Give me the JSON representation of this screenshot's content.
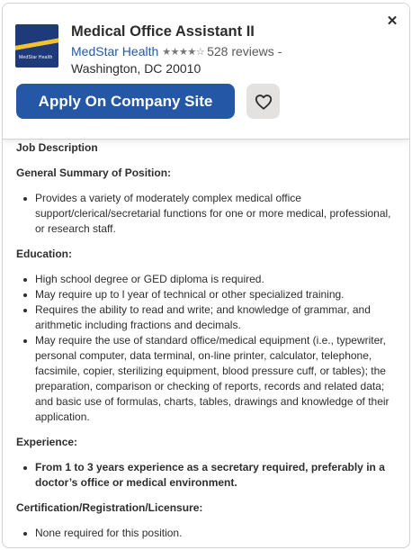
{
  "job": {
    "title": "Medical Office Assistant II",
    "company": "MedStar Health",
    "rating": 3.5,
    "reviews": "528 reviews",
    "separator": "-",
    "location": "Washington, DC 20010"
  },
  "logo": {
    "text": "MedStar Health",
    "colors": {
      "bg": "#1f3a7a",
      "accent": "#f2c230"
    }
  },
  "actions": {
    "apply_label": "Apply On Company Site",
    "close_icon": "close-icon",
    "save_icon": "heart-icon"
  },
  "colors": {
    "primary": "#2557a7",
    "secondary_bg": "#e4e2e0",
    "text": "#2d2d2d"
  },
  "description": {
    "heading": "Job Description",
    "summary_heading": "General Summary of Position:",
    "summary_items": [
      "Provides a variety of moderately complex medical office support/clerical/secretarial functions for one or more medical, professional, or research staff."
    ],
    "education_heading": "Education:",
    "education_items": [
      "High school degree or GED diploma is required.",
      "May require up to l year of technical or other specialized training.",
      "Requires the ability to read and write; and knowledge of grammar, and arithmetic including fractions and decimals.",
      "May require the use of standard office/medical equipment (i.e., typewriter, personal computer, data terminal, on-line printer, calculator, telephone, facsimile, copier, sterilizing equipment, blood pressure cuff, or tables); the preparation, comparison or checking of reports, records and related data; and basic use of formulas, charts, tables, drawings and knowledge of their application."
    ],
    "experience_heading": "Experience:",
    "experience_items": [
      "From 1 to 3 years experience as a secretary required, preferably in a doctor’s office or medical environment."
    ],
    "cert_heading": "Certification/Registration/Licensure:",
    "cert_items": [
      "None required for this position."
    ]
  }
}
